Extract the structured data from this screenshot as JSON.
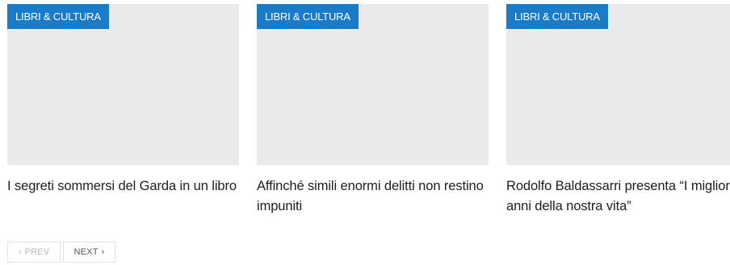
{
  "articles": [
    {
      "category": "LIBRI & CULTURA",
      "title": "I segreti sommersi del Garda in un libro"
    },
    {
      "category": "LIBRI & CULTURA",
      "title": "Affinché simili enormi delitti non restino impuniti"
    },
    {
      "category": "LIBRI & CULTURA",
      "title": "Rodolfo Baldassarri presenta “I migliori anni della nostra vita”"
    }
  ],
  "pagination": {
    "prev_label": "PREV",
    "next_label": "NEXT",
    "prev_icon": "chevron-left-icon",
    "next_icon": "chevron-right-icon",
    "prev_disabled": true
  },
  "colors": {
    "category_badge": "#1a7bc8",
    "thumbnail_placeholder": "#eaeaec",
    "title_text": "#1e1e1e"
  }
}
